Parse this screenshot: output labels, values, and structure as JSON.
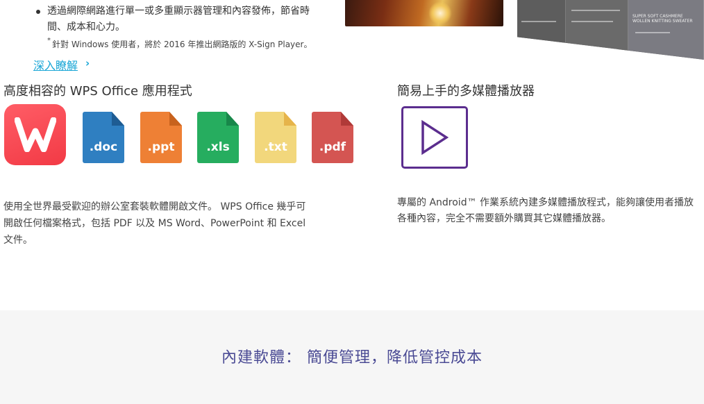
{
  "feature_list": {
    "bullet": "透過網際網路進行單一或多重顯示器管理和內容發佈，節省時間、成本和心力。",
    "note_mark": "*",
    "note": "針對 Windows 使用者，將於 2016 年推出網路版的 X-Sign Player。",
    "learn_more": "深入瞭解",
    "chevron": "›"
  },
  "menu_board": {
    "items": [
      "SUPER SOFT CASHMERE WOLLEN KNITTING SWEATER"
    ]
  },
  "wps": {
    "title": "高度相容的 WPS Office 應用程式",
    "icons": [
      {
        "ext": ".doc",
        "color": "#2f7fc1",
        "fold": "#1e5c93"
      },
      {
        "ext": ".ppt",
        "color": "#ee8035",
        "fold": "#c8621d"
      },
      {
        "ext": ".xls",
        "color": "#26ad5f",
        "fold": "#18874a"
      },
      {
        "ext": ".txt",
        "color": "#f2d77c",
        "fold": "#e6b44a"
      },
      {
        "ext": ".pdf",
        "color": "#d45552",
        "fold": "#b03a38"
      }
    ],
    "description": "使用全世界最受歡迎的辦公室套裝軟體開啟文件。 WPS Office 幾乎可開啟任何檔案格式，包括 PDF 以及 MS Word、PowerPoint 和 Excel 文件。"
  },
  "media_player": {
    "title": "簡易上手的多媒體播放器",
    "description": "專屬的 Android™ 作業系統內建多媒體播放程式，能夠讓使用者播放各種內容，完全不需要額外購買其它媒體播放器。"
  },
  "footer": {
    "heading": "內建軟體： 簡便管理，降低管控成本"
  },
  "colors": {
    "link": "#19a6d6",
    "player_accent": "#5b2d8e",
    "footer_heading": "#4a4a94",
    "wps_red": "#f23a45"
  }
}
